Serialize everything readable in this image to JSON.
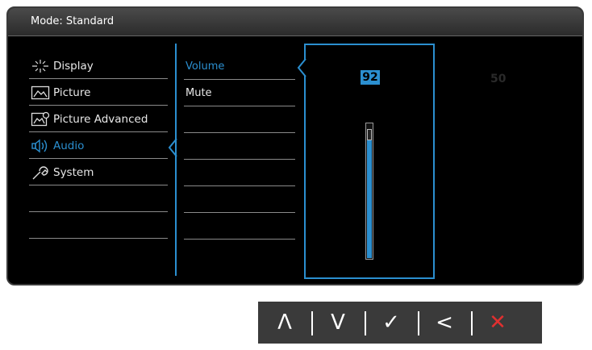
{
  "header": {
    "title": "Mode: Standard"
  },
  "main_menu": [
    {
      "label": "Display",
      "icon": "display-icon",
      "selected": false
    },
    {
      "label": "Picture",
      "icon": "picture-icon",
      "selected": false
    },
    {
      "label": "Picture Advanced",
      "icon": "picture-advanced-icon",
      "selected": false
    },
    {
      "label": "Audio",
      "icon": "audio-icon",
      "selected": true
    },
    {
      "label": "System",
      "icon": "system-icon",
      "selected": false
    }
  ],
  "sub_menu": [
    {
      "label": "Volume",
      "selected": true
    },
    {
      "label": "Mute",
      "selected": false
    }
  ],
  "value_panel": {
    "current_value": "92",
    "slider_level": 0.92
  },
  "side_value": "50",
  "keys": [
    {
      "glyph": "Λ",
      "icon": "up-icon"
    },
    {
      "glyph": "V",
      "icon": "down-icon"
    },
    {
      "glyph": "✓",
      "icon": "check-icon"
    },
    {
      "glyph": "<",
      "icon": "back-icon"
    },
    {
      "glyph": "✕",
      "icon": "close-icon"
    }
  ],
  "colors": {
    "accent": "#2b8fd0",
    "close": "#e03030"
  }
}
